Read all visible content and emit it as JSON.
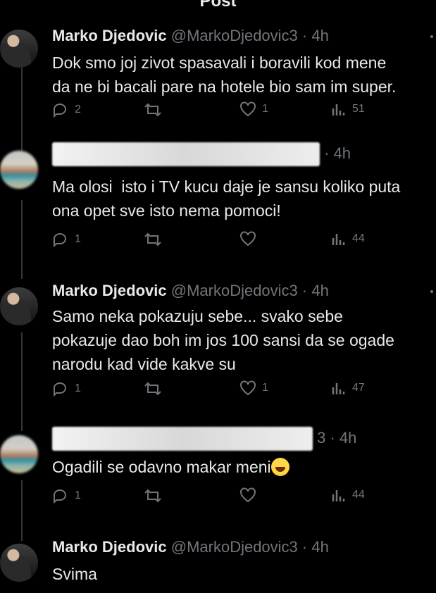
{
  "header": {
    "title": "Post"
  },
  "tweets": [
    {
      "author": "Marko Djedovic",
      "handle": "@MarkoDjedovic3",
      "time": "· 4h",
      "lines": [
        "Dok smo joj zivot spasavali i boravili kod mene",
        "da ne bi bacali pare na hotele bio sam im super."
      ],
      "replies": "2",
      "likes": "1",
      "views": "51"
    },
    {
      "time": "· 4h",
      "lines": [
        "Ma olosi  isto i TV kucu daje je sansu koliko puta",
        "ona opet sve isto nema pomoci!"
      ],
      "replies": "1",
      "likes": "",
      "views": "44"
    },
    {
      "author": "Marko Djedovic",
      "handle": "@MarkoDjedovic3",
      "time": "· 4h",
      "lines": [
        "Samo neka pokazuju sebe... svako sebe",
        "pokazuje dao boh im jos 100 sansi da se ogade",
        "narodu kad vide kakve su"
      ],
      "replies": "1",
      "likes": "1",
      "views": "47"
    },
    {
      "time": "3 · 4h",
      "lines": [
        "Ogadili se odavno makar meni"
      ],
      "emoji": "laughing-face",
      "replies": "1",
      "likes": "",
      "views": "44"
    },
    {
      "author": "Marko Djedovic",
      "handle": "@MarkoDjedovic3",
      "time": "· 4h",
      "lines": [
        "Svima"
      ]
    }
  ],
  "icons": [
    "reply-icon",
    "retweet-icon",
    "like-icon",
    "views-icon"
  ],
  "colors": {
    "background": "#000000",
    "text": "#e7e9ea",
    "muted": "#71767b"
  }
}
